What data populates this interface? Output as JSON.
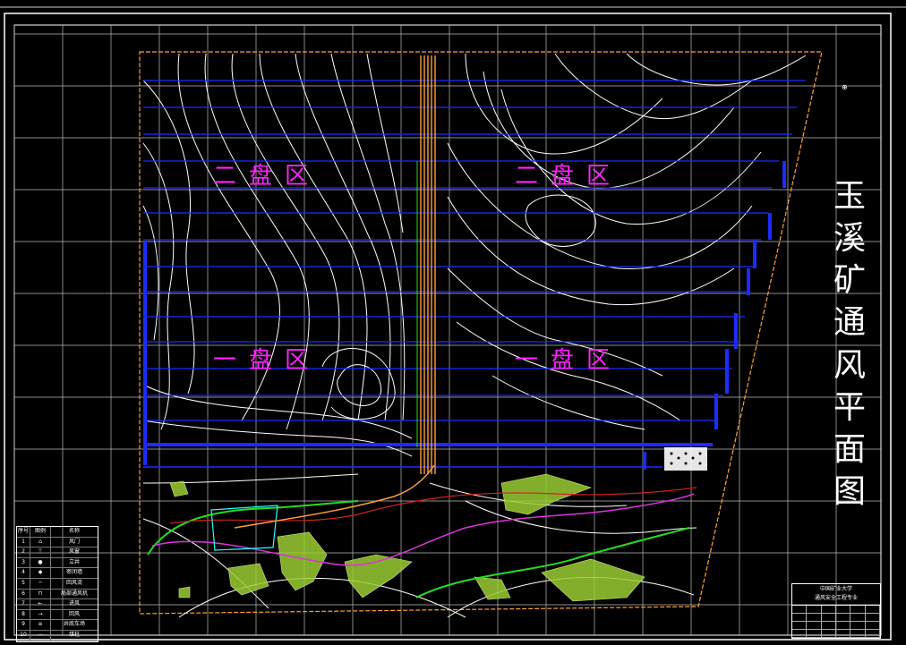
{
  "drawing": {
    "title_chars": [
      "玉",
      "溪",
      "矿",
      "通",
      "风",
      "平",
      "面",
      "图"
    ],
    "zones": [
      {
        "id": "upper-left",
        "label": "二盘区"
      },
      {
        "id": "upper-right",
        "label": "二盘区"
      },
      {
        "id": "lower-left",
        "label": "一盘区"
      },
      {
        "id": "lower-right",
        "label": "一盘区"
      }
    ]
  },
  "legend": {
    "headers": [
      "序号",
      "图例",
      "名称"
    ],
    "rows": [
      {
        "no": "1",
        "sym": "⌂",
        "name": "风门"
      },
      {
        "no": "2",
        "sym": "⊤",
        "name": "风窗"
      },
      {
        "no": "3",
        "sym": "●",
        "name": "立井"
      },
      {
        "no": "4",
        "sym": "◆",
        "name": "密闭墙"
      },
      {
        "no": "5",
        "sym": "─",
        "name": "回风流"
      },
      {
        "no": "6",
        "sym": "⊓",
        "name": "局部通风机"
      },
      {
        "no": "7",
        "sym": "←",
        "name": "进风"
      },
      {
        "no": "8",
        "sym": "→",
        "name": "回风"
      },
      {
        "no": "9",
        "sym": "≡",
        "name": "井底车场"
      },
      {
        "no": "10",
        "sym": "⋯",
        "name": "煤柱"
      }
    ]
  },
  "title_block": {
    "line1": "中国矿业大学",
    "line2": "通风安全工程专业"
  },
  "colors": {
    "background": "#000000",
    "frame": "#ffffff",
    "grid": "#cccccc",
    "contour": "#ffffff",
    "airway_blue": "#1a2cff",
    "shaft_orange": "#ffa033",
    "zone_label": "#ff22ff",
    "geology_fill": "#9acd32",
    "green_line": "#22dd22",
    "magenta_line": "#dd33dd",
    "red_line": "#cc2222",
    "cyan_line": "#22ffff"
  }
}
